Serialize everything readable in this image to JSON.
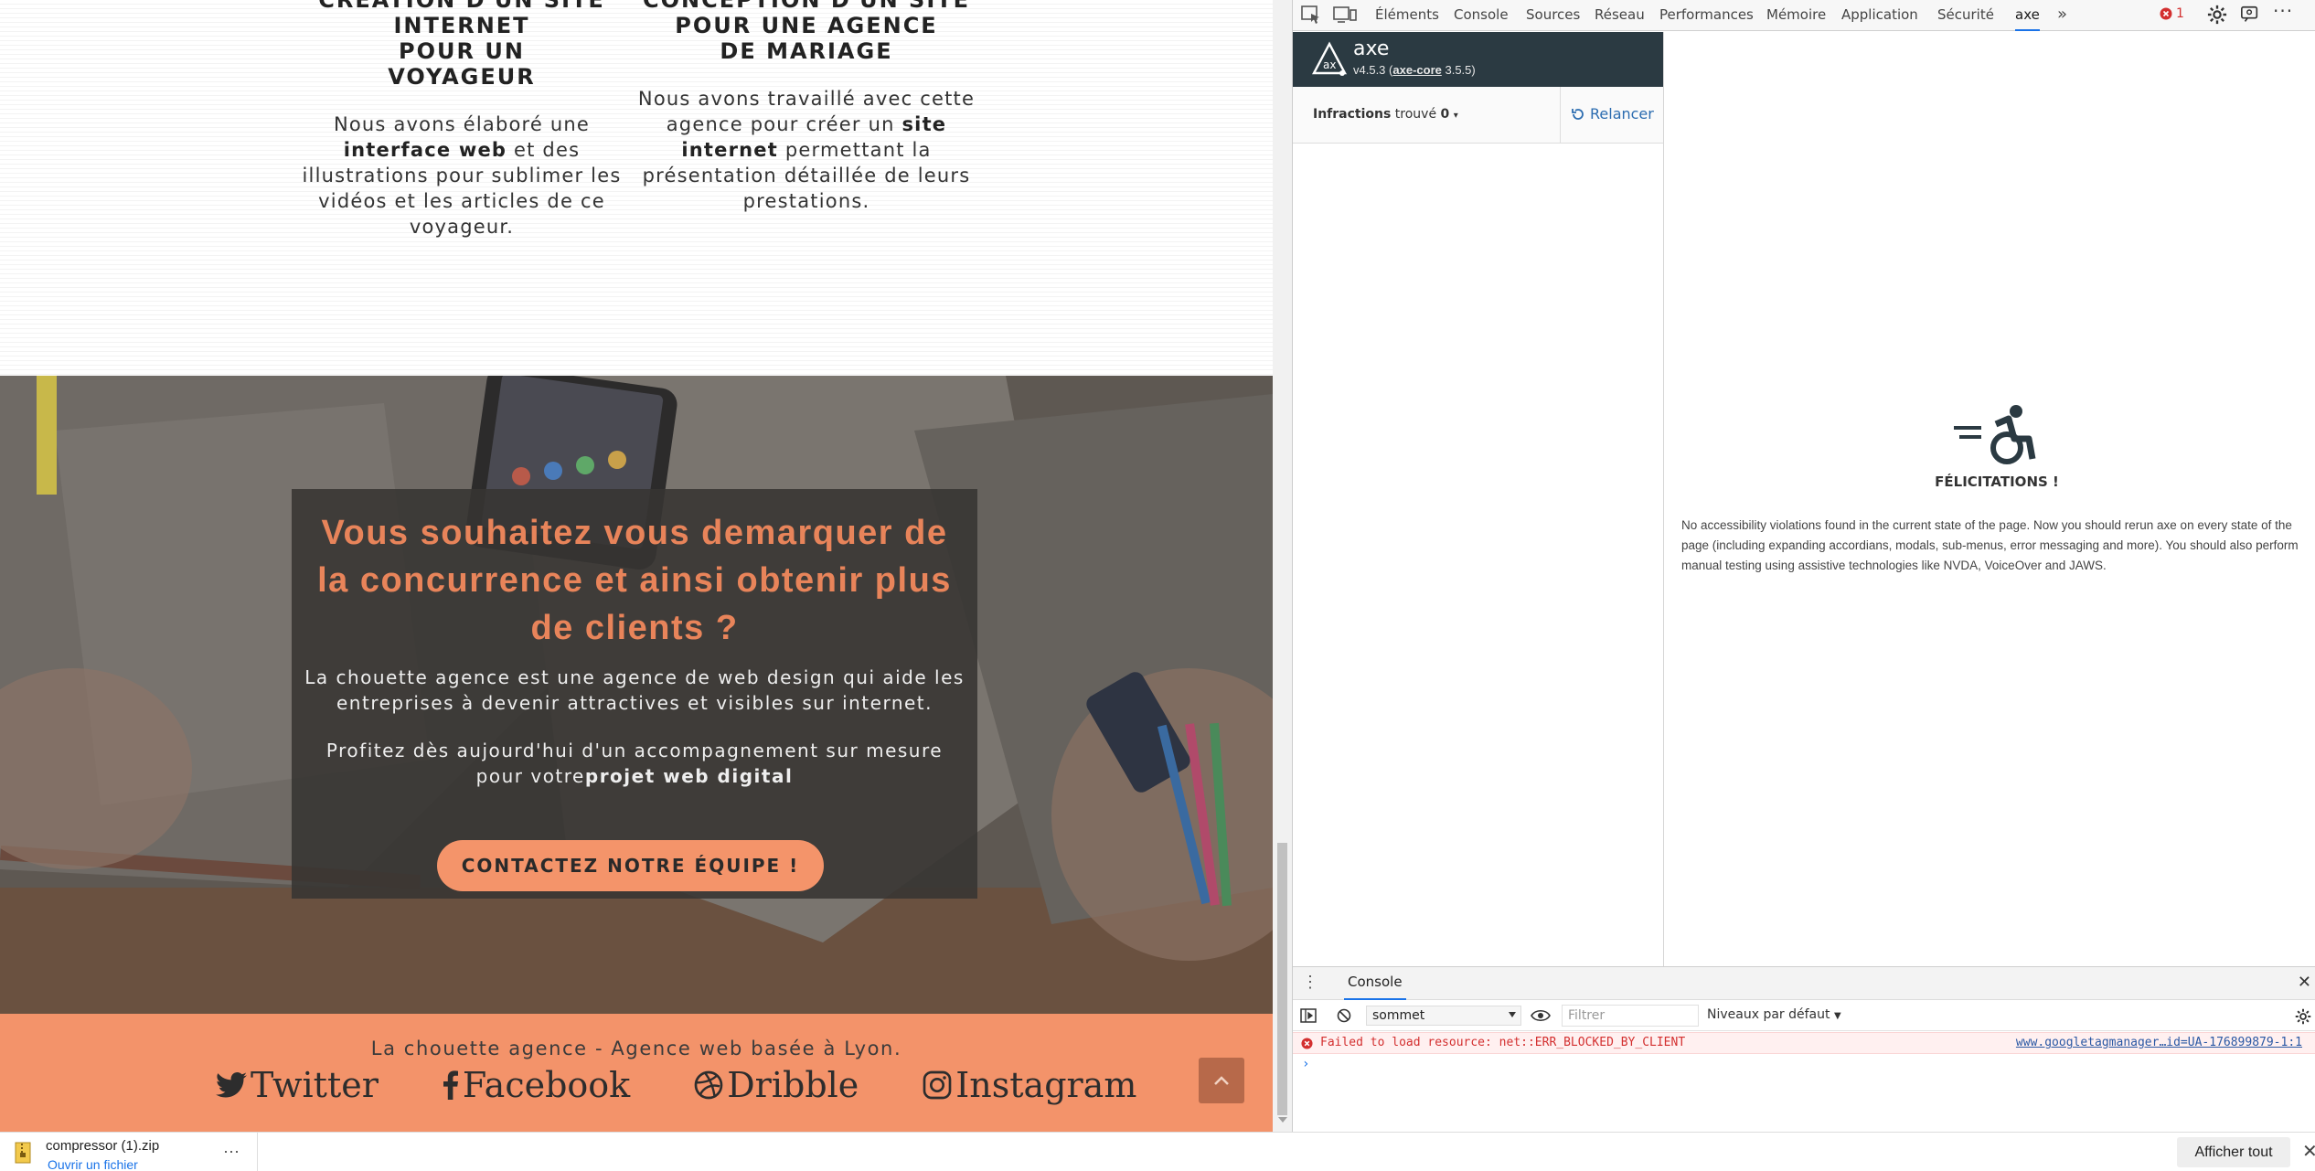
{
  "site": {
    "projects": [
      {
        "title_partial": "CRÉATION D'UN SITE",
        "title": "INTERNET POUR UN VOYAGEUR",
        "desc_before": "Nous avons élaboré une ",
        "desc_bold": "interface web",
        "desc_after": " et des illustrations pour sublimer les vidéos et les articles de ce voyageur."
      },
      {
        "title_partial": "CONCEPTION D'UN SITE",
        "title": "POUR UNE AGENCE DE MARIAGE",
        "desc_before": "Nous avons travaillé avec cette agence pour créer un ",
        "desc_bold": "site internet",
        "desc_after": " permettant la présentation détaillée de leurs prestations."
      }
    ],
    "hero": {
      "title": "Vous souhaitez vous demarquer de la concurrence et ainsi obtenir plus de clients ?",
      "text1": "La chouette agence est une agence de web design qui aide les entreprises à devenir attractives et visibles sur internet.",
      "text2_before": "Profitez dès aujourd'hui d'un accompagnement sur mesure pour votre",
      "text2_bold": "projet web digital",
      "cta": "CONTACTEZ NOTRE ÉQUIPE !"
    },
    "footer": {
      "tagline": "La chouette agence - Agence web basée à Lyon.",
      "socials": [
        "Twitter",
        "Facebook",
        "Dribble",
        "Instagram"
      ]
    }
  },
  "devtools": {
    "tabs": [
      "Éléments",
      "Console",
      "Sources",
      "Réseau",
      "Performances",
      "Mémoire",
      "Application",
      "Sécurité",
      "axe"
    ],
    "active_tab": "axe",
    "error_count": "1",
    "axe": {
      "name": "axe",
      "version": "v4.5.3",
      "core_label": "axe-core",
      "core_version": "3.5.5",
      "issues_label": "Infractions",
      "found_label": "trouvé",
      "found_count": "0",
      "rerun": "Relancer",
      "congrats_title": "FÉLICITATIONS !",
      "congrats_msg": "No accessibility violations found in the current state of the page. Now you should rerun axe on every state of the page (including expanding accordians, modals, sub-menus, error messaging and more). You should also perform manual testing using assistive technologies like NVDA, VoiceOver and JAWS."
    },
    "drawer": {
      "tab": "Console",
      "context": "sommet",
      "filter_placeholder": "Filtrer",
      "levels": "Niveaux par défaut",
      "error_msg": "Failed to load resource: net::ERR_BLOCKED_BY_CLIENT",
      "error_src": "www.googletagmanager…id=UA-176899879-1:1",
      "prompt": "›"
    }
  },
  "downloads": {
    "file": "compressor (1).zip",
    "open": "Ouvrir un fichier",
    "show_all": "Afficher tout"
  },
  "colors": {
    "accent": "#f3936a",
    "hero_title": "#e8845a",
    "axe_header": "#2b3a42",
    "link": "#1a73e8",
    "error": "#d32f2f"
  }
}
